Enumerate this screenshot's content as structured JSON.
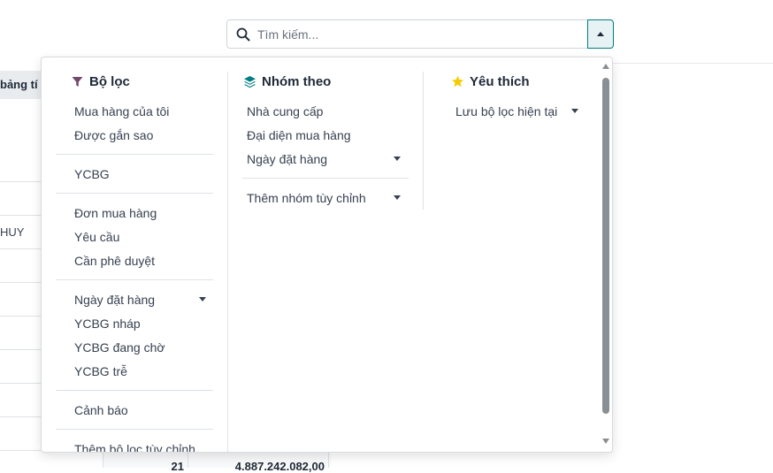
{
  "search": {
    "placeholder": "Tìm kiếm...",
    "value": ""
  },
  "background": {
    "header_cell": "bảng tí",
    "row_text": "HUY",
    "footer_count": "21",
    "footer_total": "4.887.242.082,00"
  },
  "filters": {
    "title": "Bộ lọc",
    "groups": [
      [
        "Mua hàng của tôi",
        "Được gắn sao"
      ],
      [
        "YCBG"
      ],
      [
        "Đơn mua hàng",
        "Yêu cầu",
        "Cần phê duyệt"
      ],
      [
        "Ngày đặt hàng",
        "YCBG nháp",
        "YCBG đang chờ",
        "YCBG trễ"
      ],
      [
        "Cảnh báo"
      ],
      [
        "Thêm bộ lọc tùy chỉnh"
      ]
    ]
  },
  "group_by": {
    "title": "Nhóm theo",
    "items": [
      "Nhà cung cấp",
      "Đại diện mua hàng",
      "Ngày đặt hàng"
    ],
    "custom": "Thêm nhóm tùy chỉnh"
  },
  "favorites": {
    "title": "Yêu thích",
    "save": "Lưu bộ lọc hiện tại"
  },
  "colors": {
    "accent": "#017e84",
    "filter_icon": "#714b67",
    "group_icon": "#017e84",
    "star_icon": "#f3cc00"
  },
  "icons": {
    "search": "search-icon",
    "toggle": "caret-up-icon",
    "filter": "filter-icon",
    "group": "layers-icon",
    "favorite": "star-icon"
  }
}
